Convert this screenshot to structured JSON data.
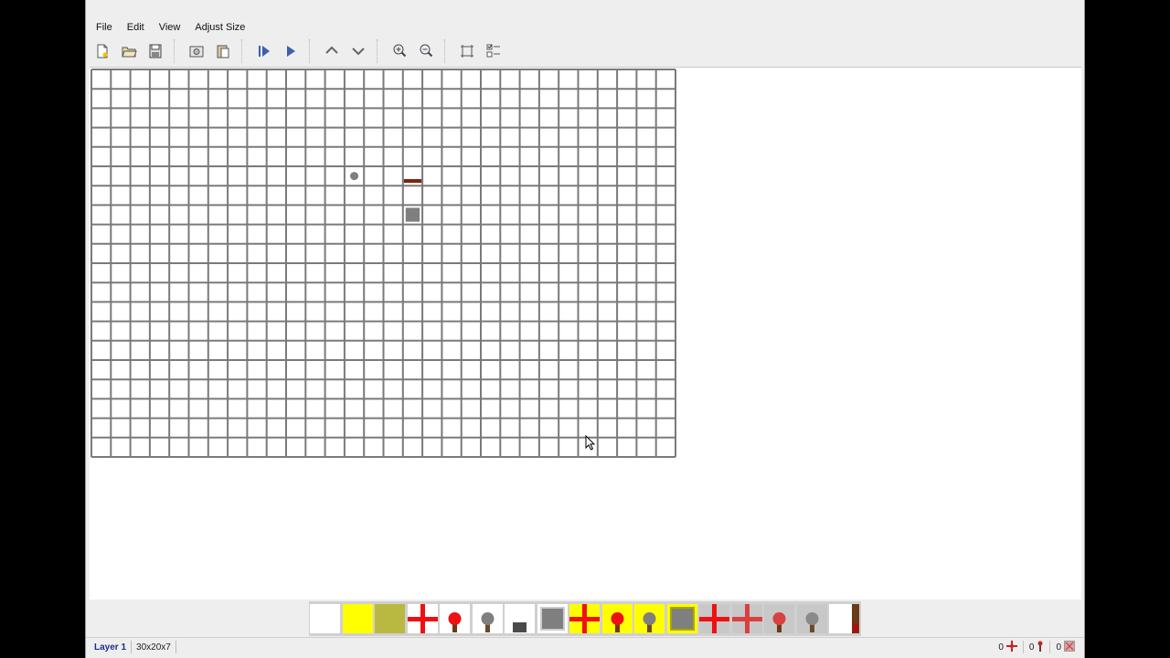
{
  "menu": {
    "items": [
      {
        "label": "File"
      },
      {
        "label": "Edit"
      },
      {
        "label": "View"
      },
      {
        "label": "Adjust Size"
      }
    ]
  },
  "toolbar": {
    "buttons": [
      {
        "name": "new-file-icon"
      },
      {
        "name": "open-folder-icon"
      },
      {
        "name": "save-disk-icon"
      },
      {
        "name": "screenshot-icon"
      },
      {
        "name": "paste-icon"
      },
      {
        "name": "step-forward-icon"
      },
      {
        "name": "play-icon"
      },
      {
        "name": "layer-up-icon"
      },
      {
        "name": "layer-down-icon"
      },
      {
        "name": "zoom-in-icon"
      },
      {
        "name": "zoom-out-icon"
      },
      {
        "name": "fit-frame-icon"
      },
      {
        "name": "checklist-icon"
      }
    ]
  },
  "grid": {
    "columns": 30,
    "rows": 20,
    "line_color": "#7a7a7a",
    "placed_items": [
      {
        "type": "torch-dot",
        "col": 13,
        "row": 5,
        "color": "#7f7f7f"
      },
      {
        "type": "wire-bar",
        "col": 16,
        "row": 5,
        "color": "#7a2410"
      },
      {
        "type": "block",
        "col": 16,
        "row": 7,
        "color": "#7f7f7f"
      }
    ]
  },
  "palette": {
    "items": [
      {
        "name": "empty-tile-icon"
      },
      {
        "name": "yellow-tile-icon"
      },
      {
        "name": "olive-tile-icon"
      },
      {
        "name": "red-cross-wire-icon"
      },
      {
        "name": "red-torch-icon"
      },
      {
        "name": "gray-torch-icon"
      },
      {
        "name": "slab-icon"
      },
      {
        "name": "gray-block-icon"
      },
      {
        "name": "yellow-red-cross-icon"
      },
      {
        "name": "yellow-red-torch-icon"
      },
      {
        "name": "yellow-gray-torch-icon"
      },
      {
        "name": "yellow-gray-block-icon"
      },
      {
        "name": "gray-red-cross-icon"
      },
      {
        "name": "gray-dim-cross-icon"
      },
      {
        "name": "gray-dim-torch-icon"
      },
      {
        "name": "gray-gray-torch-icon"
      },
      {
        "name": "wire-end-icon"
      }
    ]
  },
  "status": {
    "layer": "Layer 1",
    "size": "30x20x7",
    "counters": [
      {
        "value": "0",
        "icon": "wire-cross-icon"
      },
      {
        "value": "0",
        "icon": "torch-counter-icon"
      },
      {
        "value": "0",
        "icon": "block-counter-icon"
      }
    ]
  },
  "colors": {
    "red": "#ee1111",
    "yellow": "#ffff00",
    "olive": "#b9b942",
    "gray": "#7f7f7f",
    "brown": "#6b3a18"
  }
}
